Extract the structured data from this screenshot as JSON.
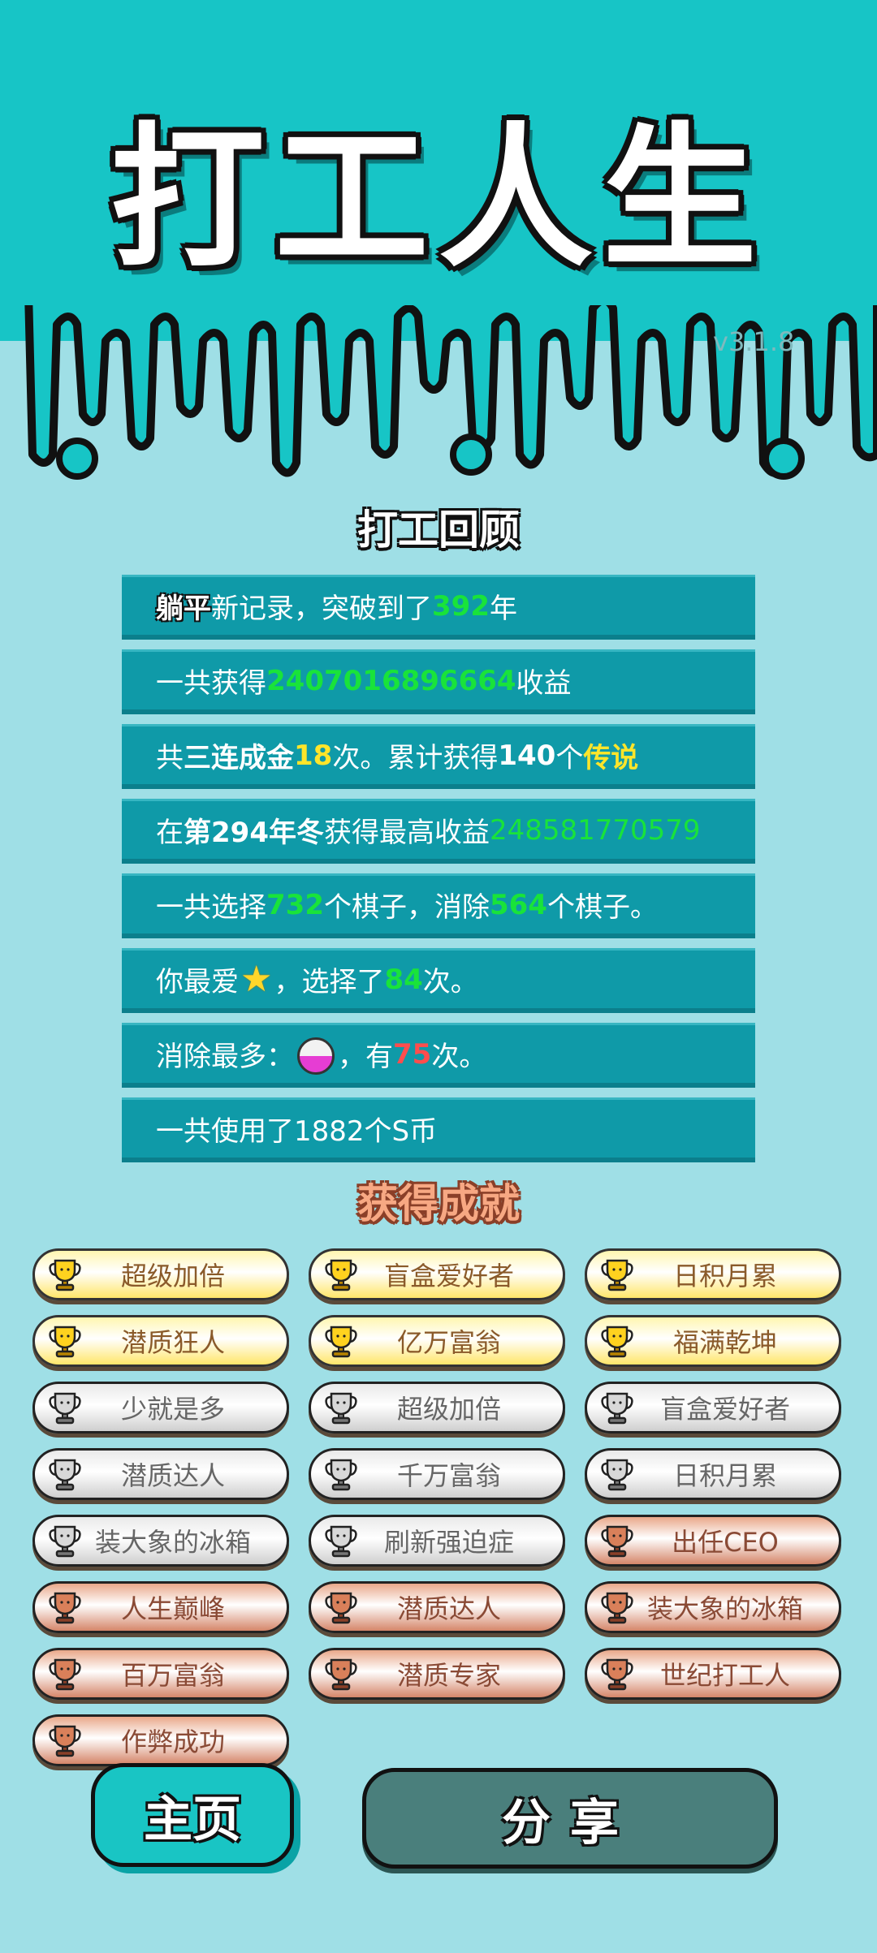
{
  "header": {
    "title": "打工人生",
    "version": "v3.1.8"
  },
  "review": {
    "title": "打工回顾",
    "row1": {
      "tag": "躺平",
      "pre": "新记录，突破到了",
      "years": "392",
      "post": "年"
    },
    "row2": {
      "pre": "一共获得",
      "income": "2407016896664",
      "post": "收益"
    },
    "row3": {
      "pre": "共",
      "combo": "三连成金",
      "combo_count": "18",
      "mid": "次。累计获得",
      "legend_count": "140",
      "mid2": "个",
      "legend": "传说"
    },
    "row4": {
      "pre": "在 ",
      "season": "第294年冬",
      "mid": " 获得最高收益",
      "max_income": "248581770579"
    },
    "row5": {
      "pre": "一共选择",
      "chosen": "732",
      "mid": "个棋子，消除",
      "removed": "564",
      "post": "个棋子。"
    },
    "row6": {
      "pre": "你最爱",
      "mid": "，选择了",
      "count": "84",
      "post": "次。"
    },
    "row7": {
      "pre": "消除最多：",
      "mid": "，有",
      "count": "75",
      "post": "次。"
    },
    "row8": {
      "text": "一共使用了1882个S币"
    }
  },
  "achievements": {
    "title": "获得成就",
    "items": [
      {
        "label": "超级加倍",
        "tier": "gold"
      },
      {
        "label": "盲盒爱好者",
        "tier": "gold"
      },
      {
        "label": "日积月累",
        "tier": "gold"
      },
      {
        "label": "潜质狂人",
        "tier": "gold"
      },
      {
        "label": "亿万富翁",
        "tier": "gold"
      },
      {
        "label": "福满乾坤",
        "tier": "gold"
      },
      {
        "label": "少就是多",
        "tier": "silver"
      },
      {
        "label": "超级加倍",
        "tier": "silver"
      },
      {
        "label": "盲盒爱好者",
        "tier": "silver"
      },
      {
        "label": "潜质达人",
        "tier": "silver"
      },
      {
        "label": "千万富翁",
        "tier": "silver"
      },
      {
        "label": "日积月累",
        "tier": "silver"
      },
      {
        "label": "装大象的冰箱",
        "tier": "silver"
      },
      {
        "label": "刷新强迫症",
        "tier": "silver"
      },
      {
        "label": "出任CEO",
        "tier": "bronze"
      },
      {
        "label": "人生巅峰",
        "tier": "bronze"
      },
      {
        "label": "潜质达人",
        "tier": "bronze"
      },
      {
        "label": "装大象的冰箱",
        "tier": "bronze"
      },
      {
        "label": "百万富翁",
        "tier": "bronze"
      },
      {
        "label": "潜质专家",
        "tier": "bronze"
      },
      {
        "label": "世纪打工人",
        "tier": "bronze"
      },
      {
        "label": "作弊成功",
        "tier": "bronze"
      }
    ]
  },
  "buttons": {
    "home": "主页",
    "share": "分享"
  },
  "colors": {
    "background": "#9fdfe6",
    "top_band": "#17c5c6",
    "row": "#0f9aa8",
    "green": "#19e33a",
    "yellow": "#ffe52a",
    "red": "#ff4d4d"
  },
  "icons": {
    "favorite_piece": "star-icon",
    "most_removed_piece": "ball-icon",
    "achievement": "trophy-icon"
  }
}
